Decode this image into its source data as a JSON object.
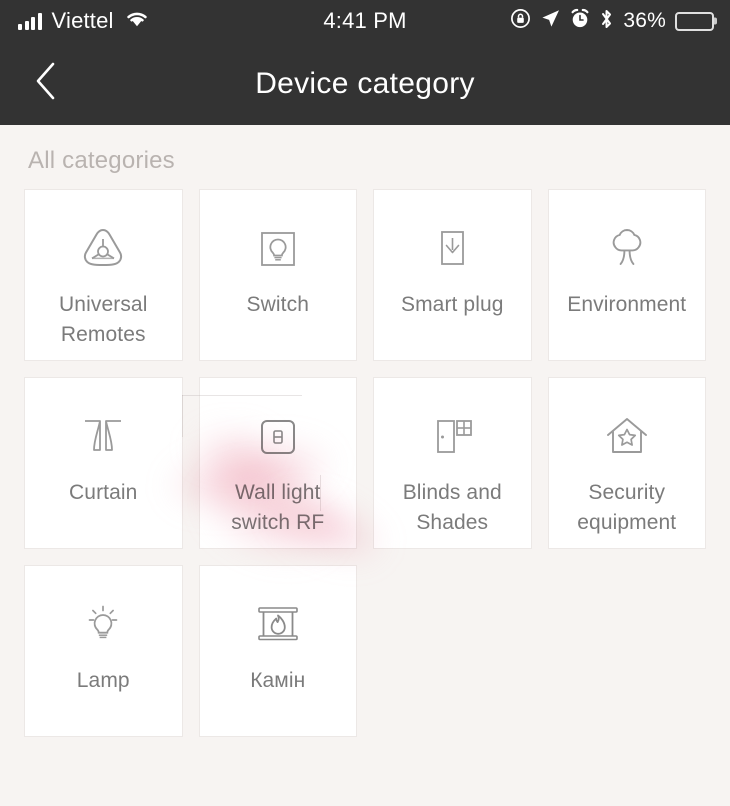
{
  "status_bar": {
    "carrier": "Viettel",
    "signal_icon": "signal-bars-icon",
    "wifi_icon": "wifi-icon",
    "time": "4:41 PM",
    "rotation_lock_icon": "rotation-lock-icon",
    "location_icon": "location-arrow-icon",
    "alarm_icon": "alarm-clock-icon",
    "bluetooth_icon": "bluetooth-icon",
    "battery_percent": "36%",
    "battery_level": 36,
    "background_color": "#333333"
  },
  "nav_bar": {
    "back_icon": "chevron-left-icon",
    "title": "Device category"
  },
  "content": {
    "section_title": "All categories",
    "background_color": "#f7f4f2",
    "card_background": "#ffffff",
    "label_color": "#7b7b7b",
    "categories": [
      {
        "label": "Universal Remotes",
        "icon": "universal-remote-icon"
      },
      {
        "label": "Switch",
        "icon": "wall-switch-bulb-icon"
      },
      {
        "label": "Smart plug",
        "icon": "smart-plug-icon"
      },
      {
        "label": "Environment",
        "icon": "tree-icon"
      },
      {
        "label": "Curtain",
        "icon": "curtain-icon"
      },
      {
        "label": "Wall light switch  RF",
        "icon": "wall-light-switch-icon"
      },
      {
        "label": "Blinds and Shades",
        "icon": "door-window-icon"
      },
      {
        "label": "Security equipment",
        "icon": "house-star-icon"
      },
      {
        "label": "Lamp",
        "icon": "light-bulb-rays-icon"
      },
      {
        "label": "Камін",
        "icon": "fireplace-flame-icon"
      }
    ]
  }
}
